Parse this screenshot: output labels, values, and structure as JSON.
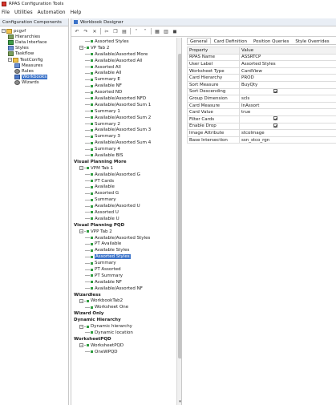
{
  "window": {
    "title": "RPAS Configuration Tools"
  },
  "menu": {
    "items": [
      "File",
      "Utilities",
      "Automation",
      "Help"
    ]
  },
  "left_panel": {
    "title": "Configuration Components",
    "tree": [
      {
        "label": "pcgvf",
        "level": 0,
        "icon": "folder-icon",
        "expander": "−"
      },
      {
        "label": "Hierarchies",
        "level": 1,
        "icon": "hierarchy-icon"
      },
      {
        "label": "Data Interface",
        "level": 1,
        "icon": "data-icon"
      },
      {
        "label": "Styles",
        "level": 1,
        "icon": "grid-icon"
      },
      {
        "label": "Taskflow",
        "level": 1,
        "icon": "taskflow-icon"
      },
      {
        "label": "TestConfig",
        "level": 1,
        "icon": "folder-icon",
        "expander": "−"
      },
      {
        "label": "Measures",
        "level": 2,
        "icon": "grid-icon"
      },
      {
        "label": "Rules",
        "level": 2,
        "icon": "rules-icon"
      },
      {
        "label": "Workbooks",
        "level": 2,
        "icon": "workbook-icon",
        "selected": true
      },
      {
        "label": "Wizards",
        "level": 2,
        "icon": "wizard-icon"
      }
    ]
  },
  "workbook_designer": {
    "title": "Workbook Designer",
    "toolbar": [
      "undo-icon",
      "redo-icon",
      "delete-icon",
      "cut-icon",
      "copy-icon",
      "paste-icon",
      "move-up-icon",
      "move-down-icon",
      "grid-view-icon",
      "list-view-icon",
      "palette-icon"
    ],
    "tree": [
      {
        "label": "Assorted Styles",
        "level": 2,
        "type": "leaf"
      },
      {
        "label": "VP Tab 2",
        "level": 1,
        "type": "tab",
        "expander": "−"
      },
      {
        "label": "Available/Assorted More",
        "level": 2,
        "type": "leaf"
      },
      {
        "label": "Available/Assorted All",
        "level": 2,
        "type": "leaf"
      },
      {
        "label": "Assorted All",
        "level": 2,
        "type": "leaf"
      },
      {
        "label": "Available All",
        "level": 2,
        "type": "leaf"
      },
      {
        "label": "Summary E",
        "level": 2,
        "type": "leaf"
      },
      {
        "label": "Available NF",
        "level": 2,
        "type": "leaf"
      },
      {
        "label": "Assorted ND",
        "level": 2,
        "type": "leaf"
      },
      {
        "label": "Available/Assorted NFD",
        "level": 2,
        "type": "leaf"
      },
      {
        "label": "Available/Assorted Sum 1",
        "level": 2,
        "type": "leaf"
      },
      {
        "label": "Summary 1",
        "level": 2,
        "type": "leaf"
      },
      {
        "label": "Available/Assorted Sum 2",
        "level": 2,
        "type": "leaf"
      },
      {
        "label": "Summary 2",
        "level": 2,
        "type": "leaf"
      },
      {
        "label": "Available/Assorted Sum 3",
        "level": 2,
        "type": "leaf"
      },
      {
        "label": "Summary 3",
        "level": 2,
        "type": "leaf"
      },
      {
        "label": "Available/Assorted Sum 4",
        "level": 2,
        "type": "leaf"
      },
      {
        "label": "Summary 4",
        "level": 2,
        "type": "leaf"
      },
      {
        "label": "Available BIS",
        "level": 2,
        "type": "leaf"
      },
      {
        "label": "Visual Planning More",
        "level": 0,
        "type": "workbook"
      },
      {
        "label": "VPM Tab 1",
        "level": 1,
        "type": "tab",
        "expander": "−"
      },
      {
        "label": "Available/Assorted G",
        "level": 2,
        "type": "leaf"
      },
      {
        "label": "PT Cards",
        "level": 2,
        "type": "leaf"
      },
      {
        "label": "Available",
        "level": 2,
        "type": "leaf"
      },
      {
        "label": "Assorted G",
        "level": 2,
        "type": "leaf"
      },
      {
        "label": "Summary",
        "level": 2,
        "type": "leaf"
      },
      {
        "label": "Available/Assorted U",
        "level": 2,
        "type": "leaf"
      },
      {
        "label": "Assorted U",
        "level": 2,
        "type": "leaf"
      },
      {
        "label": "Available U",
        "level": 2,
        "type": "leaf"
      },
      {
        "label": "Visual Planning PQD",
        "level": 0,
        "type": "workbook"
      },
      {
        "label": "VPP Tab 2",
        "level": 1,
        "type": "tab",
        "expander": "−"
      },
      {
        "label": "Available/Assorted Styles",
        "level": 2,
        "type": "leaf"
      },
      {
        "label": "PT Available",
        "level": 2,
        "type": "leaf"
      },
      {
        "label": "Available Styles",
        "level": 2,
        "type": "leaf"
      },
      {
        "label": "Assorted Styles",
        "level": 2,
        "type": "leaf",
        "selected": true
      },
      {
        "label": "Summary",
        "level": 2,
        "type": "leaf"
      },
      {
        "label": "PT Assorted",
        "level": 2,
        "type": "leaf"
      },
      {
        "label": "PT Summary",
        "level": 2,
        "type": "leaf"
      },
      {
        "label": "Available NF",
        "level": 2,
        "type": "leaf"
      },
      {
        "label": "Available/Assorted NF",
        "level": 2,
        "type": "leaf"
      },
      {
        "label": "Wizardless",
        "level": 0,
        "type": "workbook"
      },
      {
        "label": "WorkbookTab2",
        "level": 1,
        "type": "tab",
        "expander": "−"
      },
      {
        "label": "Worksheet One",
        "level": 2,
        "type": "leaf"
      },
      {
        "label": "Wizard Only",
        "level": 0,
        "type": "workbook"
      },
      {
        "label": "Dynamic Hierarchy",
        "level": 0,
        "type": "workbook"
      },
      {
        "label": "Dynamic hierarchy",
        "level": 1,
        "type": "tab",
        "expander": "−"
      },
      {
        "label": "Dynamic location",
        "level": 2,
        "type": "leaf"
      },
      {
        "label": "WorksheetPQD",
        "level": 0,
        "type": "workbook"
      },
      {
        "label": "WorksheetPQD",
        "level": 1,
        "type": "tab",
        "expander": "−"
      },
      {
        "label": "OneWPQD",
        "level": 2,
        "type": "leaf"
      }
    ]
  },
  "properties": {
    "tabs": [
      "General",
      "Card Definition",
      "Position Queries",
      "Style Overrides"
    ],
    "active_tab": "General",
    "columns": [
      "Property",
      "Value"
    ],
    "rows": [
      {
        "key": "RPAS Name",
        "value": "ASSRTCP"
      },
      {
        "key": "User Label",
        "value": "Assorted Styles"
      },
      {
        "key": "Worksheet Type",
        "value": "CardView"
      },
      {
        "key": "Card Hierarchy",
        "value": "PROD"
      },
      {
        "key": "Sort Measure",
        "value": "BuyQty"
      },
      {
        "key": "Sort Descending",
        "value": "",
        "checkbox": true
      },
      {
        "key": "Group Dimension",
        "value": "scls"
      },
      {
        "key": "Card Measure",
        "value": "InAssort"
      },
      {
        "key": "Card Value",
        "value": "true"
      },
      {
        "key": "Filter Cards",
        "value": "",
        "checkbox": true
      },
      {
        "key": "Enable Drop",
        "value": "",
        "checkbox": true
      },
      {
        "key": "Image Attribute",
        "value": "stcoImage"
      },
      {
        "key": "Base Intersection",
        "value": "ssn_stco_rgn"
      }
    ]
  }
}
